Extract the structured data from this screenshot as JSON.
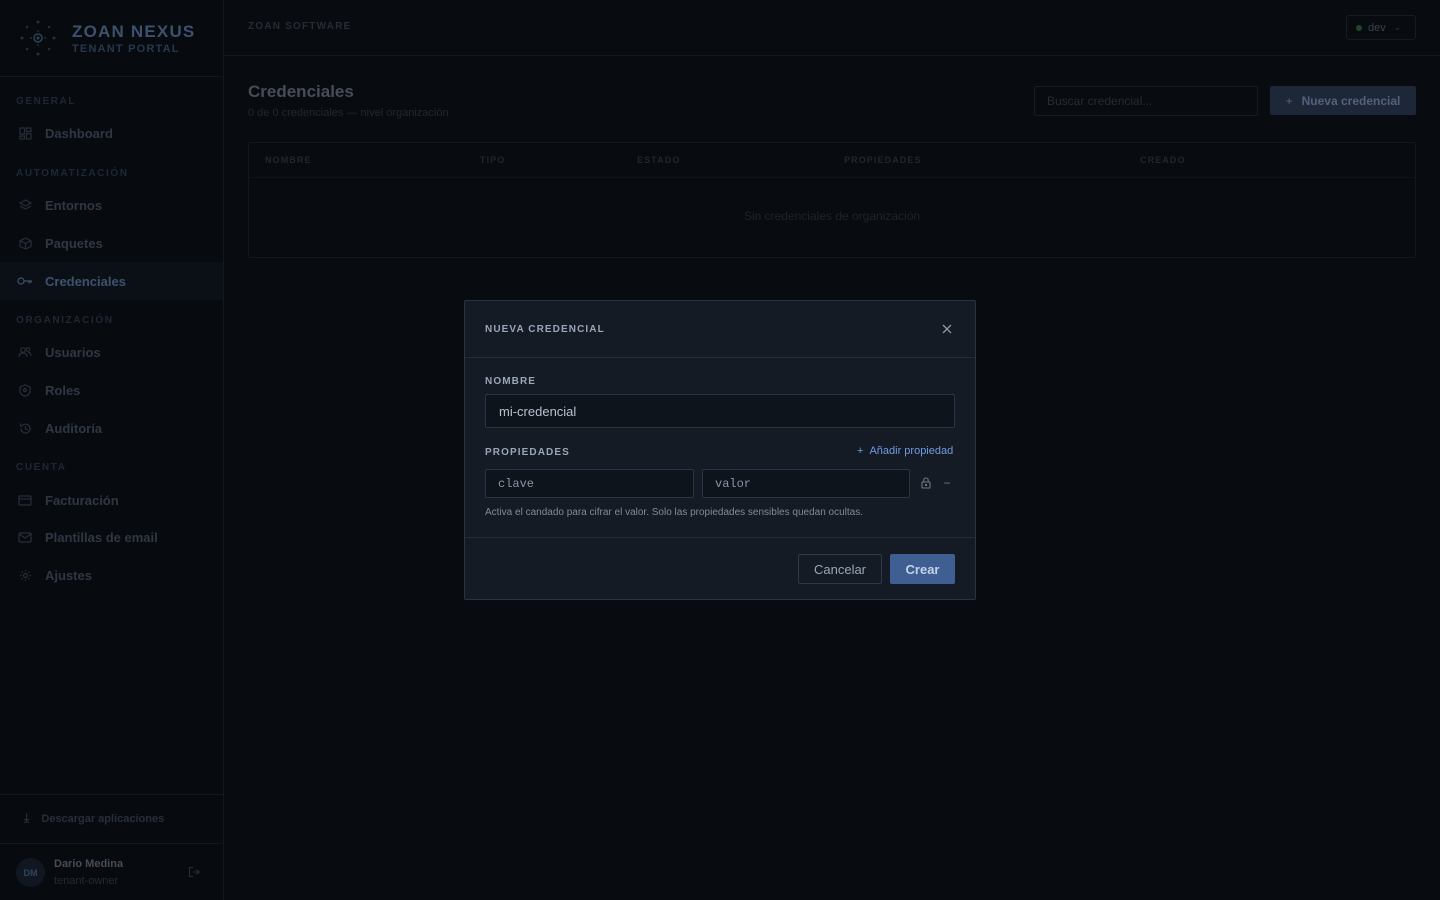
{
  "brand": {
    "title": "ZOAN NEXUS",
    "subtitle": "TENANT PORTAL"
  },
  "sidebar": {
    "sections": [
      {
        "label": "GENERAL"
      },
      {
        "label": "AUTOMATIZACIÓN"
      },
      {
        "label": "ORGANIZACIÓN"
      },
      {
        "label": "CUENTA"
      }
    ],
    "items": [
      {
        "label": "Dashboard",
        "icon": "dashboard-icon"
      },
      {
        "label": "Entornos",
        "icon": "layers-icon"
      },
      {
        "label": "Paquetes",
        "icon": "package-icon"
      },
      {
        "label": "Credenciales",
        "icon": "key-icon",
        "active": true
      },
      {
        "label": "Usuarios",
        "icon": "users-icon"
      },
      {
        "label": "Roles",
        "icon": "shield-icon"
      },
      {
        "label": "Auditoría",
        "icon": "history-icon"
      },
      {
        "label": "Facturación",
        "icon": "credit-card-icon"
      },
      {
        "label": "Plantillas de email",
        "icon": "mail-icon"
      },
      {
        "label": "Ajustes",
        "icon": "gear-icon"
      }
    ],
    "download_label": "Descargar aplicaciones",
    "user": {
      "initials": "DM",
      "name": "Dario Medina",
      "role": "tenant-owner"
    }
  },
  "topbar": {
    "company": "ZOAN SOFTWARE",
    "environment": "dev",
    "environment_color": "#2f6b45"
  },
  "page": {
    "title": "Credenciales",
    "subtitle": "0 de 0 credenciales — nivel organización",
    "search_placeholder": "Buscar credencial...",
    "new_button": "Nueva credencial",
    "table": {
      "columns": [
        "NOMBRE",
        "TIPO",
        "ESTADO",
        "PROPIEDADES",
        "CREADO"
      ],
      "empty_message": "Sin credenciales de organización"
    }
  },
  "modal": {
    "title": "NUEVA CREDENCIAL",
    "name_label": "NOMBRE",
    "name_value": "mi-credencial",
    "properties_label": "PROPIEDADES",
    "add_property": "Añadir propiedad",
    "key_placeholder": "clave",
    "value_placeholder": "valor",
    "hint": "Activa el candado para cifrar el valor. Solo las propiedades sensibles quedan ocultas.",
    "cancel": "Cancelar",
    "create": "Crear"
  },
  "colors": {
    "accent": "#3f5e91",
    "link": "#6f9be0",
    "background": "#0d1117"
  }
}
